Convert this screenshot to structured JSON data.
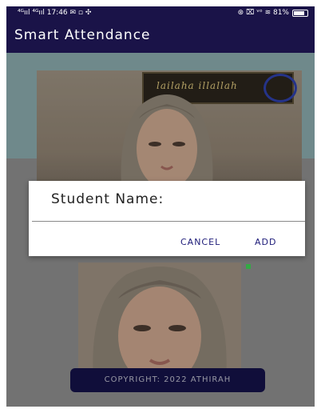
{
  "status_bar": {
    "left_text": "⁴ᴳııl ⁴ᴳııl 17:46 ✉ ▫ ✣",
    "right_text": "⊛ ⌧ ᵛᵒ ≋ 81%"
  },
  "app_bar": {
    "title": "Smart Attendance"
  },
  "camera_preview": {
    "frame_text": "lailaha illallah"
  },
  "dialog": {
    "title": "Student Name:",
    "input_value": "",
    "input_placeholder": "",
    "cancel_label": "CANCEL",
    "add_label": "ADD"
  },
  "footer": {
    "copyright": "COPYRIGHT: 2022 ATHIRAH"
  },
  "colors": {
    "app_bar": "#1a1348",
    "dialog_button": "#1c1a78",
    "copyright_bg": "#141247",
    "seal": "#2e3fa8"
  }
}
